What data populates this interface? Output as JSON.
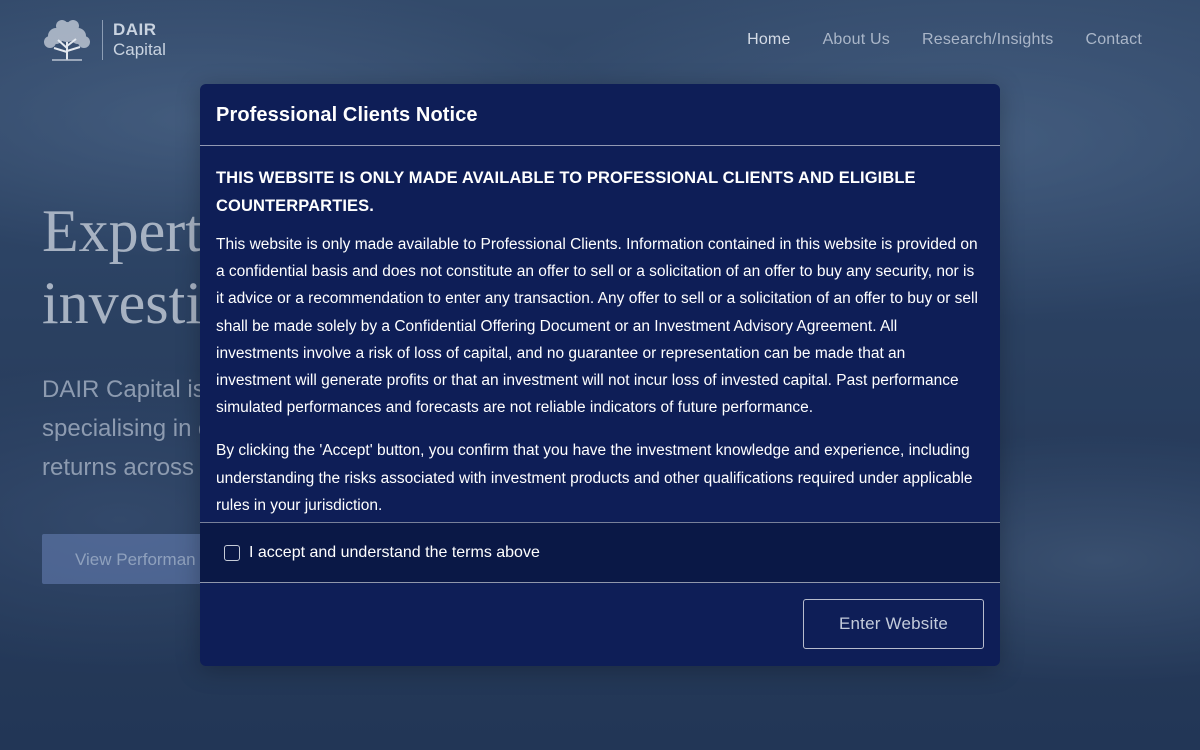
{
  "header": {
    "logo": {
      "line1": "DAIR",
      "line2": "Capital"
    },
    "nav": [
      {
        "label": "Home",
        "active": true
      },
      {
        "label": "About Us",
        "active": false
      },
      {
        "label": "Research/Insights",
        "active": false
      },
      {
        "label": "Contact",
        "active": false
      }
    ]
  },
  "hero": {
    "title_line1": "Expert",
    "title_line2": "investi",
    "subtitle_line1": "DAIR Capital is",
    "subtitle_line2": "specialising in d",
    "subtitle_line3": "returns across",
    "cta_label": "View Performan"
  },
  "modal": {
    "title": "Professional Clients Notice",
    "heading": "THIS WEBSITE IS ONLY MADE AVAILABLE TO PROFESSIONAL CLIENTS AND ELIGIBLE COUNTERPARTIES.",
    "paragraph1": "This website is only made available to Professional Clients. Information contained in this website is provided on a confidential basis and does not constitute an offer to sell or a solicitation of an offer to buy any security, nor is it advice or a recommendation to enter any transaction. Any offer to sell or a solicitation of an offer to buy or sell shall be made solely by a Confidential Offering Document or an Investment Advisory Agreement. All investments involve a risk of loss of capital, and no guarantee or representation can be made that an investment will generate profits or that an investment will not incur loss of invested capital. Past performance simulated performances and forecasts are not reliable indicators of future performance.",
    "paragraph2": "By clicking the 'Accept' button, you confirm that you have the investment knowledge and experience, including understanding the risks associated with investment products and other qualifications required under applicable rules in your jurisdiction.",
    "accept_label": "I accept and understand the terms above",
    "accept_checked": false,
    "enter_button": "Enter Website"
  },
  "colors": {
    "modal_background": "#0e1e57",
    "accept_row_background": "#0a1846",
    "nav_text": "#aab6c8"
  },
  "icons": {
    "logo": "tree-icon"
  }
}
